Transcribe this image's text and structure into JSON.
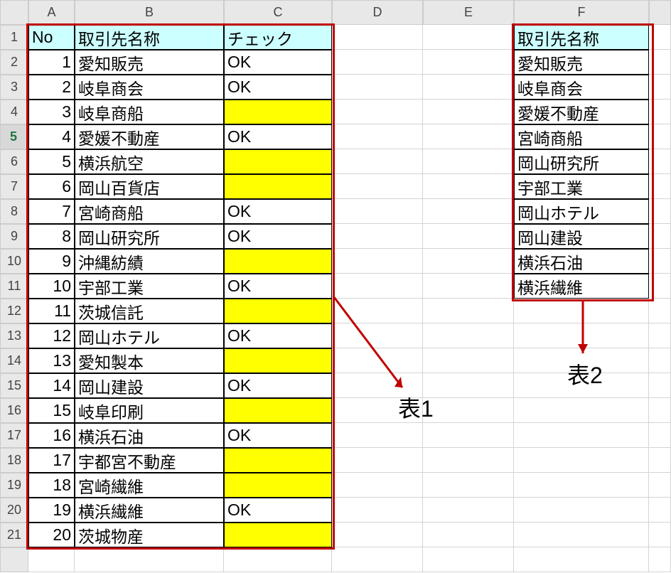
{
  "columnHeaders": [
    "A",
    "B",
    "C",
    "D",
    "E",
    "F",
    ""
  ],
  "rowHeaders": [
    "1",
    "2",
    "3",
    "4",
    "5",
    "6",
    "7",
    "8",
    "9",
    "10",
    "11",
    "12",
    "13",
    "14",
    "15",
    "16",
    "17",
    "18",
    "19",
    "20",
    "21",
    ""
  ],
  "selectedRow": "5",
  "table1": {
    "headers": {
      "no": "No",
      "name": "取引先名称",
      "check": "チェック"
    },
    "rows": [
      {
        "no": "1",
        "name": "愛知販売",
        "check": "OK",
        "hl": false
      },
      {
        "no": "2",
        "name": "岐阜商会",
        "check": "OK",
        "hl": false
      },
      {
        "no": "3",
        "name": "岐阜商船",
        "check": "",
        "hl": true
      },
      {
        "no": "4",
        "name": "愛媛不動産",
        "check": "OK",
        "hl": false
      },
      {
        "no": "5",
        "name": "横浜航空",
        "check": "",
        "hl": true
      },
      {
        "no": "6",
        "name": "岡山百貨店",
        "check": "",
        "hl": true
      },
      {
        "no": "7",
        "name": "宮崎商船",
        "check": "OK",
        "hl": false
      },
      {
        "no": "8",
        "name": "岡山研究所",
        "check": "OK",
        "hl": false
      },
      {
        "no": "9",
        "name": "沖縄紡績",
        "check": "",
        "hl": true
      },
      {
        "no": "10",
        "name": "宇部工業",
        "check": "OK",
        "hl": false
      },
      {
        "no": "11",
        "name": "茨城信託",
        "check": "",
        "hl": true
      },
      {
        "no": "12",
        "name": "岡山ホテル",
        "check": "OK",
        "hl": false
      },
      {
        "no": "13",
        "name": "愛知製本",
        "check": "",
        "hl": true
      },
      {
        "no": "14",
        "name": "岡山建設",
        "check": "OK",
        "hl": false
      },
      {
        "no": "15",
        "name": "岐阜印刷",
        "check": "",
        "hl": true
      },
      {
        "no": "16",
        "name": "横浜石油",
        "check": "OK",
        "hl": false
      },
      {
        "no": "17",
        "name": "宇都宮不動産",
        "check": "",
        "hl": true
      },
      {
        "no": "18",
        "name": "宮崎繊維",
        "check": "",
        "hl": true
      },
      {
        "no": "19",
        "name": "横浜繊維",
        "check": "OK",
        "hl": false
      },
      {
        "no": "20",
        "name": "茨城物産",
        "check": "",
        "hl": true
      }
    ]
  },
  "table2": {
    "header": "取引先名称",
    "rows": [
      "愛知販売",
      "岐阜商会",
      "愛媛不動産",
      "宮崎商船",
      "岡山研究所",
      "宇部工業",
      "岡山ホテル",
      "岡山建設",
      "横浜石油",
      "横浜繊維"
    ]
  },
  "labels": {
    "t1": "表1",
    "t2": "表2"
  },
  "chart_data": {
    "type": "table",
    "tables": [
      {
        "title": "表1",
        "columns": [
          "No",
          "取引先名称",
          "チェック"
        ],
        "rows": [
          [
            1,
            "愛知販売",
            "OK"
          ],
          [
            2,
            "岐阜商会",
            "OK"
          ],
          [
            3,
            "岐阜商船",
            ""
          ],
          [
            4,
            "愛媛不動産",
            "OK"
          ],
          [
            5,
            "横浜航空",
            ""
          ],
          [
            6,
            "岡山百貨店",
            ""
          ],
          [
            7,
            "宮崎商船",
            "OK"
          ],
          [
            8,
            "岡山研究所",
            "OK"
          ],
          [
            9,
            "沖縄紡績",
            ""
          ],
          [
            10,
            "宇部工業",
            "OK"
          ],
          [
            11,
            "茨城信託",
            ""
          ],
          [
            12,
            "岡山ホテル",
            "OK"
          ],
          [
            13,
            "愛知製本",
            ""
          ],
          [
            14,
            "岡山建設",
            "OK"
          ],
          [
            15,
            "岐阜印刷",
            ""
          ],
          [
            16,
            "横浜石油",
            "OK"
          ],
          [
            17,
            "宇都宮不動産",
            ""
          ],
          [
            18,
            "宮崎繊維",
            ""
          ],
          [
            19,
            "横浜繊維",
            "OK"
          ],
          [
            20,
            "茨城物産",
            ""
          ]
        ]
      },
      {
        "title": "表2",
        "columns": [
          "取引先名称"
        ],
        "rows": [
          [
            "愛知販売"
          ],
          [
            "岐阜商会"
          ],
          [
            "愛媛不動産"
          ],
          [
            "宮崎商船"
          ],
          [
            "岡山研究所"
          ],
          [
            "宇部工業"
          ],
          [
            "岡山ホテル"
          ],
          [
            "岡山建設"
          ],
          [
            "横浜石油"
          ],
          [
            "横浜繊維"
          ]
        ]
      }
    ]
  }
}
